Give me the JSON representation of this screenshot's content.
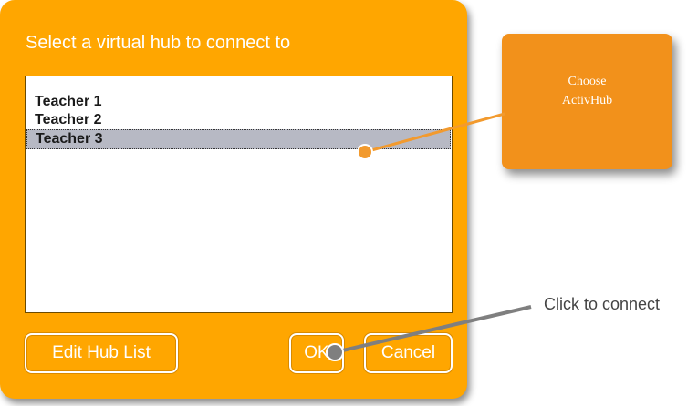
{
  "dialog": {
    "title": "Select a virtual hub to connect to",
    "hubs": [
      {
        "label": "Teacher 1",
        "selected": false
      },
      {
        "label": "Teacher 2",
        "selected": false
      },
      {
        "label": "Teacher 3",
        "selected": true
      }
    ],
    "edit_label": "Edit Hub List",
    "ok_label": "OK",
    "cancel_label": "Cancel"
  },
  "annotations": {
    "callout_line1": "Choose",
    "callout_line2": "ActivHub",
    "click_hint": "Click to connect"
  },
  "colors": {
    "dialog_bg": "#ffa600",
    "callout_bg": "#f2911b",
    "selection_bg": "#b7b9c4",
    "marker_orange": "#f29a2e",
    "marker_gray": "#7f7f7f"
  }
}
